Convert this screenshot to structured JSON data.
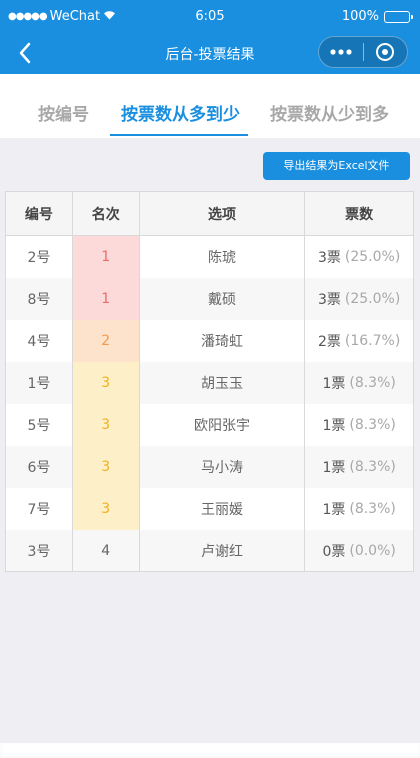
{
  "status_bar": {
    "carrier": "WeChat",
    "time": "6:05",
    "battery": "100%",
    "battery_level": 1.0
  },
  "nav": {
    "title": "后台-投票结果"
  },
  "tabs": [
    {
      "label": "按编号",
      "active": false
    },
    {
      "label": "按票数从多到少",
      "active": true
    },
    {
      "label": "按票数从少到多",
      "active": false
    }
  ],
  "export_button": "导出结果为Excel文件",
  "table": {
    "headers": [
      "编号",
      "名次",
      "选项",
      "票数"
    ],
    "rows": [
      {
        "id": "2号",
        "rank": "1",
        "name": "陈琥",
        "votes": "3票",
        "pct": "(25.0%)"
      },
      {
        "id": "8号",
        "rank": "1",
        "name": "戴硕",
        "votes": "3票",
        "pct": "(25.0%)"
      },
      {
        "id": "4号",
        "rank": "2",
        "name": "潘琦虹",
        "votes": "2票",
        "pct": "(16.7%)"
      },
      {
        "id": "1号",
        "rank": "3",
        "name": "胡玉玉",
        "votes": "1票",
        "pct": "(8.3%)"
      },
      {
        "id": "5号",
        "rank": "3",
        "name": "欧阳张宇",
        "votes": "1票",
        "pct": "(8.3%)"
      },
      {
        "id": "6号",
        "rank": "3",
        "name": "马小涛",
        "votes": "1票",
        "pct": "(8.3%)"
      },
      {
        "id": "7号",
        "rank": "3",
        "name": "王丽媛",
        "votes": "1票",
        "pct": "(8.3%)"
      },
      {
        "id": "3号",
        "rank": "4",
        "name": "卢谢红",
        "votes": "0票",
        "pct": "(0.0%)"
      }
    ]
  },
  "colors": {
    "primary": "#1a8fe0",
    "rank1_bg": "#fcdada",
    "rank2_bg": "#fde2cc",
    "rank3_bg": "#fdf0c8"
  }
}
